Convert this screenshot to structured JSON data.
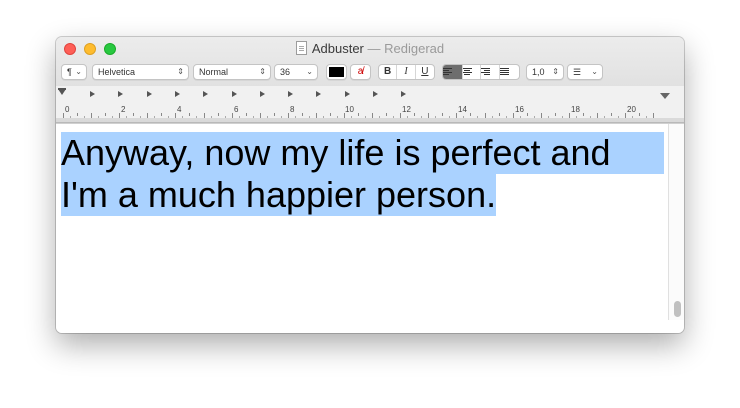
{
  "window": {
    "title": "Adbuster",
    "status": "— Redigerad"
  },
  "toolbar": {
    "paragraph_label": "¶",
    "font_family": "Helvetica",
    "font_style": "Normal",
    "font_size": "36",
    "text_color": "#000000",
    "bold": "B",
    "italic": "I",
    "underline": "U",
    "line_spacing": "1,0",
    "list_label": "☰"
  },
  "ruler": {
    "labels": [
      "0",
      "2",
      "4",
      "6",
      "8",
      "10",
      "12",
      "14",
      "16",
      "18",
      "20"
    ]
  },
  "document": {
    "line1": "Anyway, now my life is perfect and",
    "line2": "I'm a much happier person."
  },
  "colors": {
    "selection": "#aad2ff",
    "close": "#fe5f57",
    "minimize": "#febc2e",
    "maximize": "#28c840"
  }
}
